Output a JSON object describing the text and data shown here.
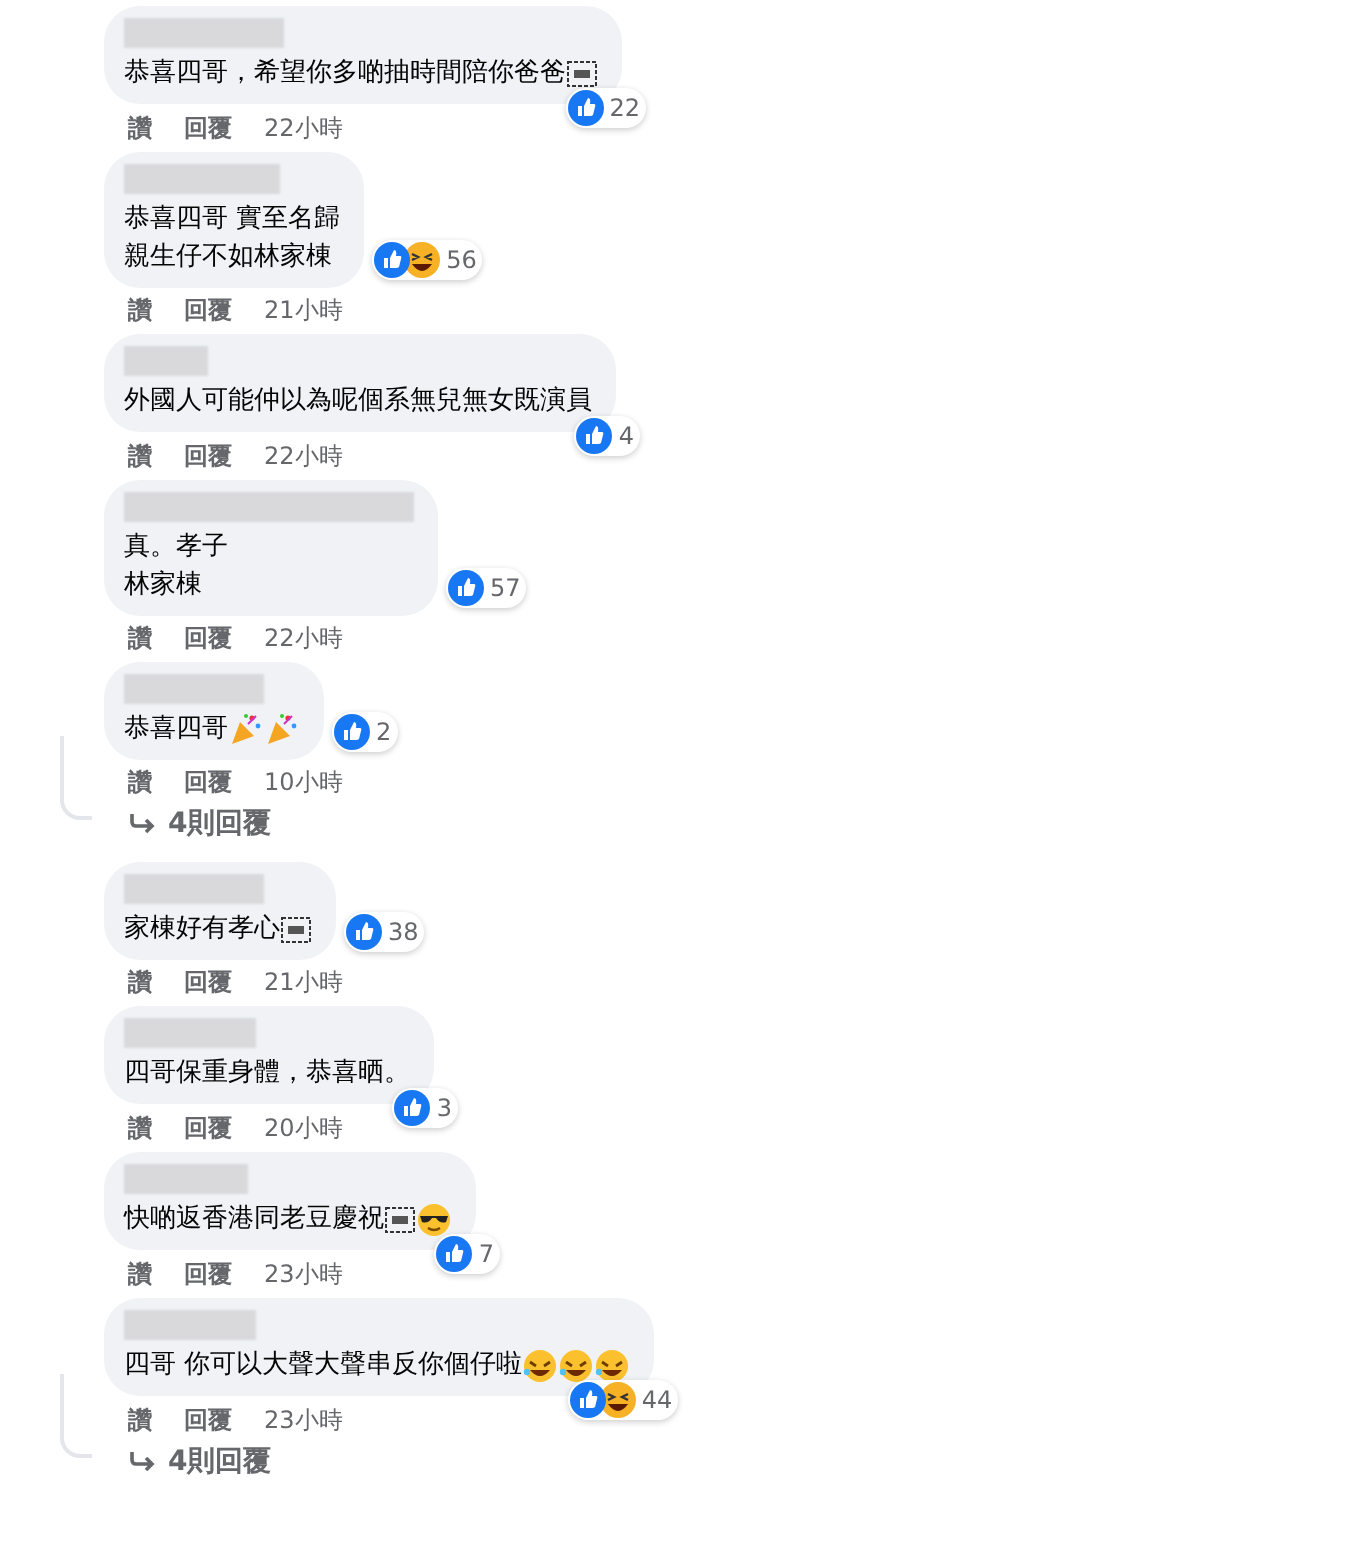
{
  "comments": [
    {
      "lines": [
        "恭喜四哥，希望你多啲抽時間陪你爸爸"
      ],
      "emojis": [
        {
          "kind": "object"
        }
      ],
      "reactions": [
        {
          "kind": "like"
        }
      ],
      "count": "22",
      "actions": [
        "讚",
        "回覆"
      ],
      "time": "22小時"
    },
    {
      "lines": [
        "恭喜四哥 實至名歸",
        "親生仔不如林家棟"
      ],
      "reactions": [
        {
          "kind": "like"
        },
        {
          "kind": "haha"
        }
      ],
      "count": "56",
      "actions": [
        "讚",
        "回覆"
      ],
      "time": "21小時"
    },
    {
      "lines": [
        "外國人可能仲以為呢個系無兒無女既演員"
      ],
      "reactions": [
        {
          "kind": "like"
        }
      ],
      "count": "4",
      "actions": [
        "讚",
        "回覆"
      ],
      "time": "22小時"
    },
    {
      "lines": [
        "真。孝子",
        "林家棟"
      ],
      "reactions": [
        {
          "kind": "like"
        }
      ],
      "count": "57",
      "actions": [
        "讚",
        "回覆"
      ],
      "time": "22小時"
    },
    {
      "lines": [
        "恭喜四哥"
      ],
      "emojis": [
        {
          "kind": "party"
        },
        {
          "kind": "party"
        }
      ],
      "reactions": [
        {
          "kind": "like"
        }
      ],
      "count": "2",
      "actions": [
        "讚",
        "回覆"
      ],
      "time": "10小時",
      "replies": "4則回覆"
    },
    {
      "lines": [
        "家棟好有孝心"
      ],
      "emojis": [
        {
          "kind": "object"
        }
      ],
      "reactions": [
        {
          "kind": "like"
        }
      ],
      "count": "38",
      "actions": [
        "讚",
        "回覆"
      ],
      "time": "21小時"
    },
    {
      "lines": [
        "四哥保重身體，恭喜晒。"
      ],
      "reactions": [
        {
          "kind": "like"
        }
      ],
      "count": "3",
      "actions": [
        "讚",
        "回覆"
      ],
      "time": "20小時"
    },
    {
      "lines": [
        "快啲返香港同老豆慶祝"
      ],
      "emojis": [
        {
          "kind": "object"
        },
        {
          "kind": "cool"
        }
      ],
      "reactions": [
        {
          "kind": "like"
        }
      ],
      "count": "7",
      "actions": [
        "讚",
        "回覆"
      ],
      "time": "23小時"
    },
    {
      "lines": [
        "四哥 你可以大聲大聲串反你個仔啦"
      ],
      "emojis": [
        {
          "kind": "rofl"
        },
        {
          "kind": "rofl"
        },
        {
          "kind": "rofl"
        }
      ],
      "reactions": [
        {
          "kind": "like"
        },
        {
          "kind": "haha"
        }
      ],
      "count": "44",
      "actions": [
        "讚",
        "回覆"
      ],
      "time": "23小時",
      "replies": "4則回覆"
    }
  ]
}
